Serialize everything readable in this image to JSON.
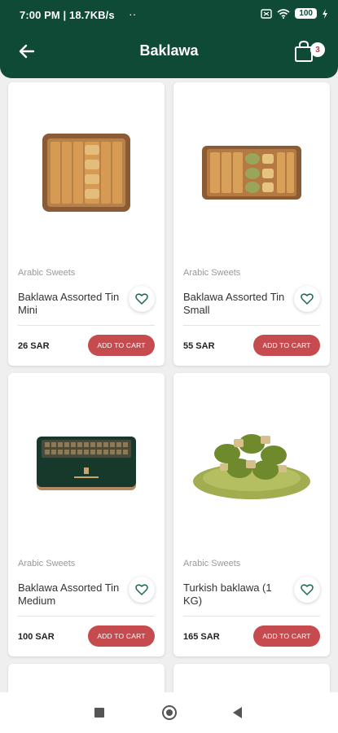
{
  "status_bar": {
    "time_speed": "7:00 PM | 18.7KB/s",
    "dots": "··",
    "battery": "100"
  },
  "header": {
    "title": "Baklawa",
    "cart_count": "3"
  },
  "products": [
    {
      "category": "Arabic Sweets",
      "name": "Baklawa Assorted Tin Mini",
      "price": "26 SAR",
      "add_label": "ADD TO CART",
      "image": "assorted-tin-mini"
    },
    {
      "category": "Arabic Sweets",
      "name": "Baklawa Assorted Tin Small",
      "price": "55 SAR",
      "add_label": "ADD TO CART",
      "image": "assorted-tin-small"
    },
    {
      "category": "Arabic Sweets",
      "name": "Baklawa Assorted Tin Medium",
      "price": "100 SAR",
      "add_label": "ADD TO CART",
      "image": "assorted-tin-medium"
    },
    {
      "category": "Arabic Sweets",
      "name": "Turkish baklawa (1 KG)",
      "price": "165 SAR",
      "add_label": "ADD TO CART",
      "image": "turkish-baklawa"
    }
  ],
  "colors": {
    "header_bg": "#0f4a36",
    "accent_red": "#c64b4f"
  }
}
